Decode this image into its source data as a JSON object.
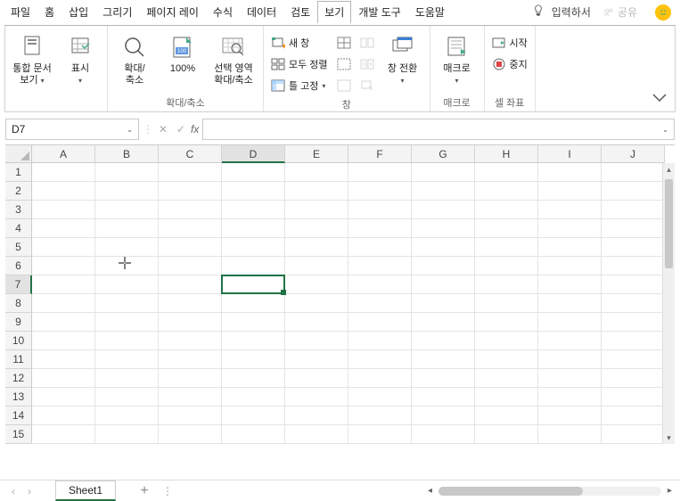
{
  "menu": {
    "items": [
      "파일",
      "홈",
      "삽입",
      "그리기",
      "페이지 레이",
      "수식",
      "데이터",
      "검토",
      "보기",
      "개발 도구",
      "도움말"
    ],
    "active_index": 8,
    "tell_me": "입력하서",
    "share": "공유"
  },
  "ribbon": {
    "groups": [
      {
        "label": "",
        "big": [
          {
            "label": "통합 문서\n보기",
            "dropdown": true
          },
          {
            "label": "표시",
            "dropdown": true
          }
        ]
      },
      {
        "label": "확대/축소",
        "big": [
          {
            "label": "확대/\n축소"
          },
          {
            "label": "100%"
          },
          {
            "label": "선택 영역\n확대/축소"
          }
        ]
      },
      {
        "label": "창",
        "small_cols": [
          [
            {
              "label": "새 창",
              "icon": "new-window-icon"
            },
            {
              "label": "모두 정렬",
              "icon": "arrange-icon"
            },
            {
              "label": "틀 고정",
              "icon": "freeze-icon",
              "dropdown": true
            }
          ],
          [
            {
              "label": "",
              "icon": "split-icon"
            },
            {
              "label": "",
              "icon": "hide-icon"
            },
            {
              "label": "",
              "icon": "unhide-icon"
            }
          ],
          [
            {
              "label": "",
              "icon": "side-icon"
            },
            {
              "label": "",
              "icon": "sync-icon"
            },
            {
              "label": "",
              "icon": "reset-icon"
            }
          ]
        ],
        "big": [
          {
            "label": "창 전환",
            "dropdown": true
          }
        ]
      },
      {
        "label": "매크로",
        "big": [
          {
            "label": "매크로",
            "dropdown": true
          }
        ]
      },
      {
        "label": "셀 좌표",
        "small_cols": [
          [
            {
              "label": "시작",
              "icon": "start-icon"
            },
            {
              "label": "중지",
              "icon": "stop-icon"
            }
          ]
        ]
      }
    ]
  },
  "formula": {
    "name_box": "D7",
    "value": ""
  },
  "grid": {
    "columns": [
      "A",
      "B",
      "C",
      "D",
      "E",
      "F",
      "G",
      "H",
      "I",
      "J"
    ],
    "rows": [
      1,
      2,
      3,
      4,
      5,
      6,
      7,
      8,
      9,
      10,
      11,
      12,
      13,
      14,
      15
    ],
    "selected_col": "D",
    "selected_row": 7
  },
  "sheets": {
    "active": "Sheet1"
  }
}
